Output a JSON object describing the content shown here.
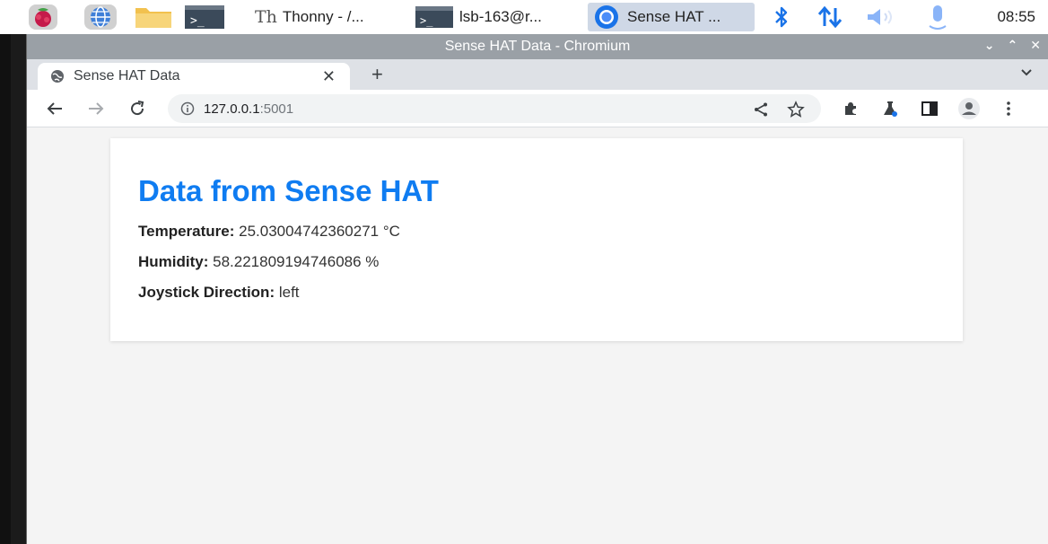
{
  "taskbar": {
    "tasks": [
      {
        "label": "Thonny  -  /..."
      },
      {
        "label": "lsb-163@r..."
      },
      {
        "label": "Sense HAT ..."
      }
    ],
    "clock": "08:55"
  },
  "window": {
    "title": "Sense HAT Data - Chromium",
    "tab_title": "Sense HAT Data",
    "url_host": "127.0.0.1",
    "url_port": ":5001"
  },
  "page": {
    "heading": "Data from Sense HAT",
    "temperature_label": "Temperature:",
    "temperature_value": "25.03004742360271 °C",
    "humidity_label": "Humidity:",
    "humidity_value": "58.221809194746086 %",
    "joystick_label": "Joystick Direction:",
    "joystick_value": "left"
  },
  "colors": {
    "heading": "#0f7cf1",
    "bluetooth": "#1a73e8",
    "network": "#1a73e8"
  }
}
